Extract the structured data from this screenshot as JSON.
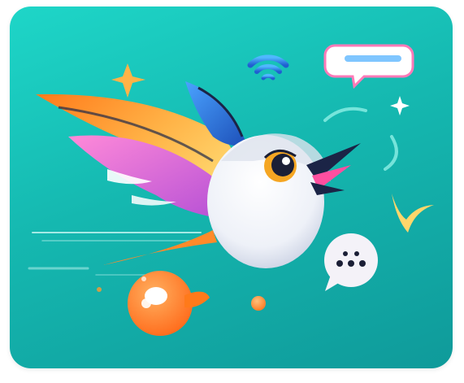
{
  "scene": {
    "description_icons": [
      "hummingbird-illustration",
      "wifi-icon",
      "chat-bubble-icon",
      "sparkle-icon",
      "typing-bubble-icon",
      "boomerang-icon",
      "orange-blob-icon"
    ],
    "colors": {
      "background_top": "#1ed6c8",
      "background_bottom": "#0f9a9a",
      "wing_orange": "#ff9a2e",
      "wing_pink": "#ef6fc9",
      "wing_blue": "#2f73d8",
      "accent_yellow": "#ffd66b",
      "body_white": "#f4f6fb"
    }
  }
}
